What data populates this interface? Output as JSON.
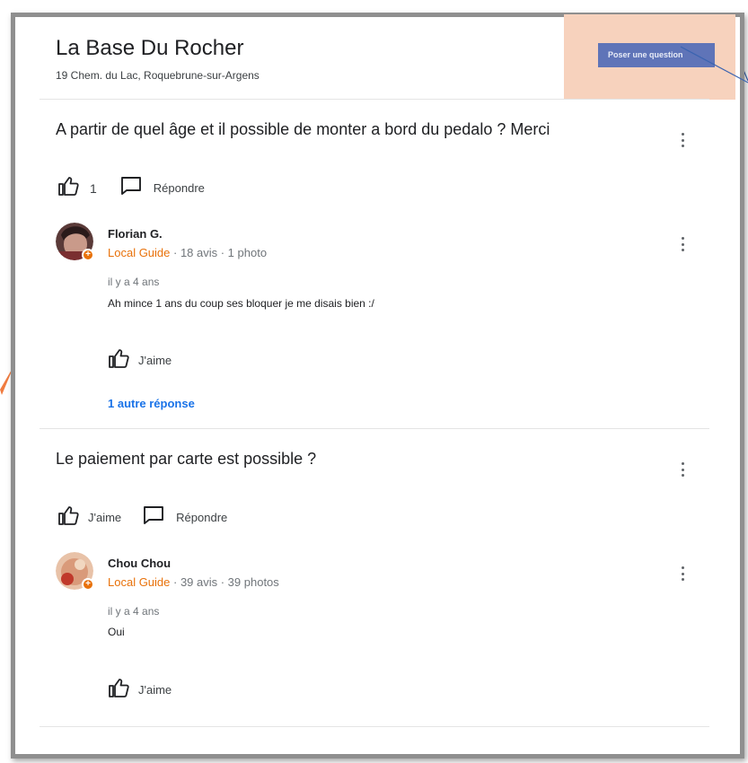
{
  "place": {
    "name": "La Base Du Rocher",
    "address": "19 Chem. du Lac, Roquebrune-sur-Argens"
  },
  "ask_button": {
    "label": "Poser une question"
  },
  "questions": [
    {
      "text": "A partir de quel âge et il possible de monter a bord du pedalo ? Merci",
      "like_count": "1",
      "reply_label": "Répondre",
      "answer": {
        "author": "Florian G.",
        "badge": "Local Guide",
        "stats": " · 18 avis · 1 photo",
        "when": "il y a 4 ans",
        "text": "Ah mince 1 ans du coup ses bloquer je me disais bien :/",
        "like_label": "J'aime"
      },
      "more_answers_label": "1 autre réponse"
    },
    {
      "text": "Le paiement par carte est possible ?",
      "like_label": "J'aime",
      "reply_label": "Répondre",
      "answer": {
        "author": "Chou Chou",
        "badge": "Local Guide",
        "stats": " · 39 avis · 39 photos",
        "when": "il y a 4 ans",
        "text": "Oui",
        "like_label": "J'aime"
      }
    }
  ],
  "colors": {
    "accent_orange": "#e8710a",
    "link_blue": "#1a73e8",
    "highlight_box": "#f7d2bd",
    "button_blue": "#5f74b8",
    "annotation_arrow": "#f07b3f"
  },
  "icons": [
    "thumbs-up-icon",
    "comment-icon",
    "more-vert-icon",
    "local-guide-badge-icon"
  ]
}
